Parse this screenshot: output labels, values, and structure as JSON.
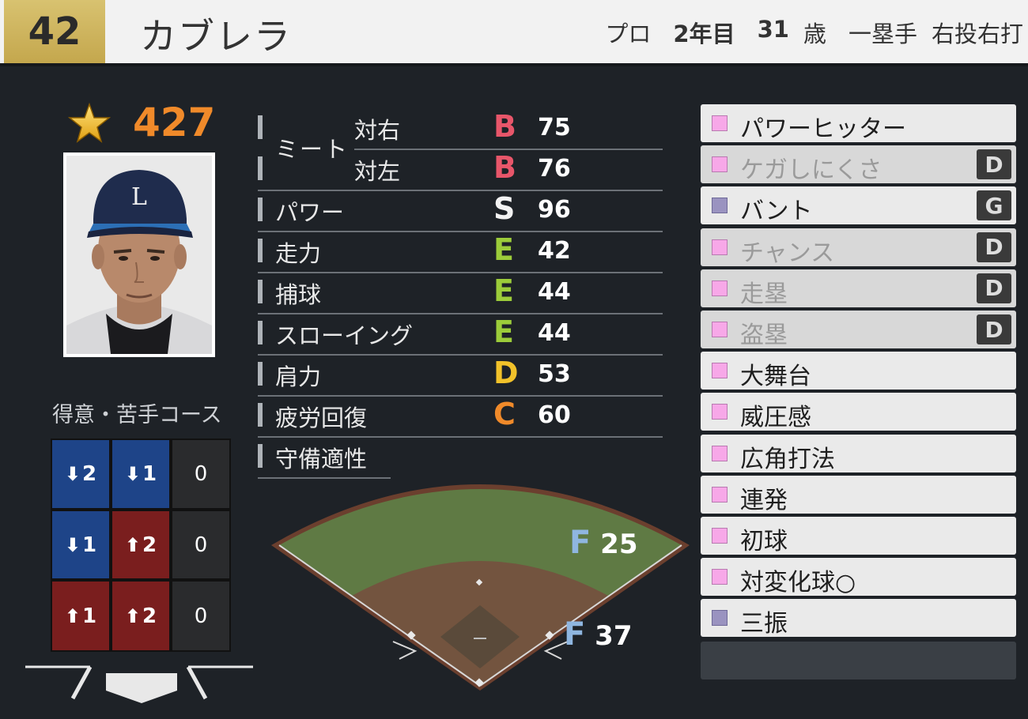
{
  "header": {
    "number": "42",
    "name": "カブレラ",
    "career_type": "プロ",
    "career_years": "2年目",
    "age": "31",
    "age_unit": "歳",
    "position": "一塁手",
    "throws_bats": "右投右打"
  },
  "overall": {
    "icon": "star-icon",
    "value": "427"
  },
  "course": {
    "title": "得意・苦手コース",
    "cells": [
      {
        "dir": "down",
        "value": "2",
        "zone": "blue"
      },
      {
        "dir": "down",
        "value": "1",
        "zone": "blue"
      },
      {
        "dir": "",
        "value": "0",
        "zone": "dark"
      },
      {
        "dir": "down",
        "value": "1",
        "zone": "blue"
      },
      {
        "dir": "up",
        "value": "2",
        "zone": "red"
      },
      {
        "dir": "",
        "value": "0",
        "zone": "dark"
      },
      {
        "dir": "up",
        "value": "1",
        "zone": "red"
      },
      {
        "dir": "up",
        "value": "2",
        "zone": "red"
      },
      {
        "dir": "",
        "value": "0",
        "zone": "dark"
      }
    ]
  },
  "ratings": {
    "meet_label": "ミート",
    "meet_right": {
      "label": "対右",
      "rank": "B",
      "value": "75"
    },
    "meet_left": {
      "label": "対左",
      "rank": "B",
      "value": "76"
    },
    "power": {
      "label": "パワー",
      "rank": "S",
      "value": "96"
    },
    "speed": {
      "label": "走力",
      "rank": "E",
      "value": "42"
    },
    "catch": {
      "label": "捕球",
      "rank": "E",
      "value": "44"
    },
    "throwing": {
      "label": "スローイング",
      "rank": "E",
      "value": "44"
    },
    "arm": {
      "label": "肩力",
      "rank": "D",
      "value": "53"
    },
    "recovery": {
      "label": "疲労回復",
      "rank": "C",
      "value": "60"
    },
    "defense_label": "守備適性"
  },
  "field_positions": [
    {
      "grade": "F",
      "value": "25",
      "pos": "right-field"
    },
    {
      "grade": "F",
      "value": "37",
      "pos": "first-base"
    }
  ],
  "abilities": [
    {
      "label": "パワーヒッター",
      "color": "pink",
      "grade": "",
      "dim": false
    },
    {
      "label": "ケガしにくさ",
      "color": "pink",
      "grade": "D",
      "dim": true
    },
    {
      "label": "バント",
      "color": "purple",
      "grade": "G",
      "dim": false
    },
    {
      "label": "チャンス",
      "color": "pink",
      "grade": "D",
      "dim": true
    },
    {
      "label": "走塁",
      "color": "pink",
      "grade": "D",
      "dim": true
    },
    {
      "label": "盗塁",
      "color": "pink",
      "grade": "D",
      "dim": true
    },
    {
      "label": "大舞台",
      "color": "pink",
      "grade": "",
      "dim": false
    },
    {
      "label": "威圧感",
      "color": "pink",
      "grade": "",
      "dim": false
    },
    {
      "label": "広角打法",
      "color": "pink",
      "grade": "",
      "dim": false
    },
    {
      "label": "連発",
      "color": "pink",
      "grade": "",
      "dim": false
    },
    {
      "label": "初球",
      "color": "pink",
      "grade": "",
      "dim": false
    },
    {
      "label": "対変化球○",
      "color": "pink",
      "grade": "",
      "dim": false
    },
    {
      "label": "三振",
      "color": "purple",
      "grade": "",
      "dim": false
    }
  ],
  "colors": {
    "accent_gold": "#c4a74d",
    "score_orange": "#f08a2a",
    "weak_zone": "#1e4488",
    "strong_zone": "#7a1e1e"
  }
}
